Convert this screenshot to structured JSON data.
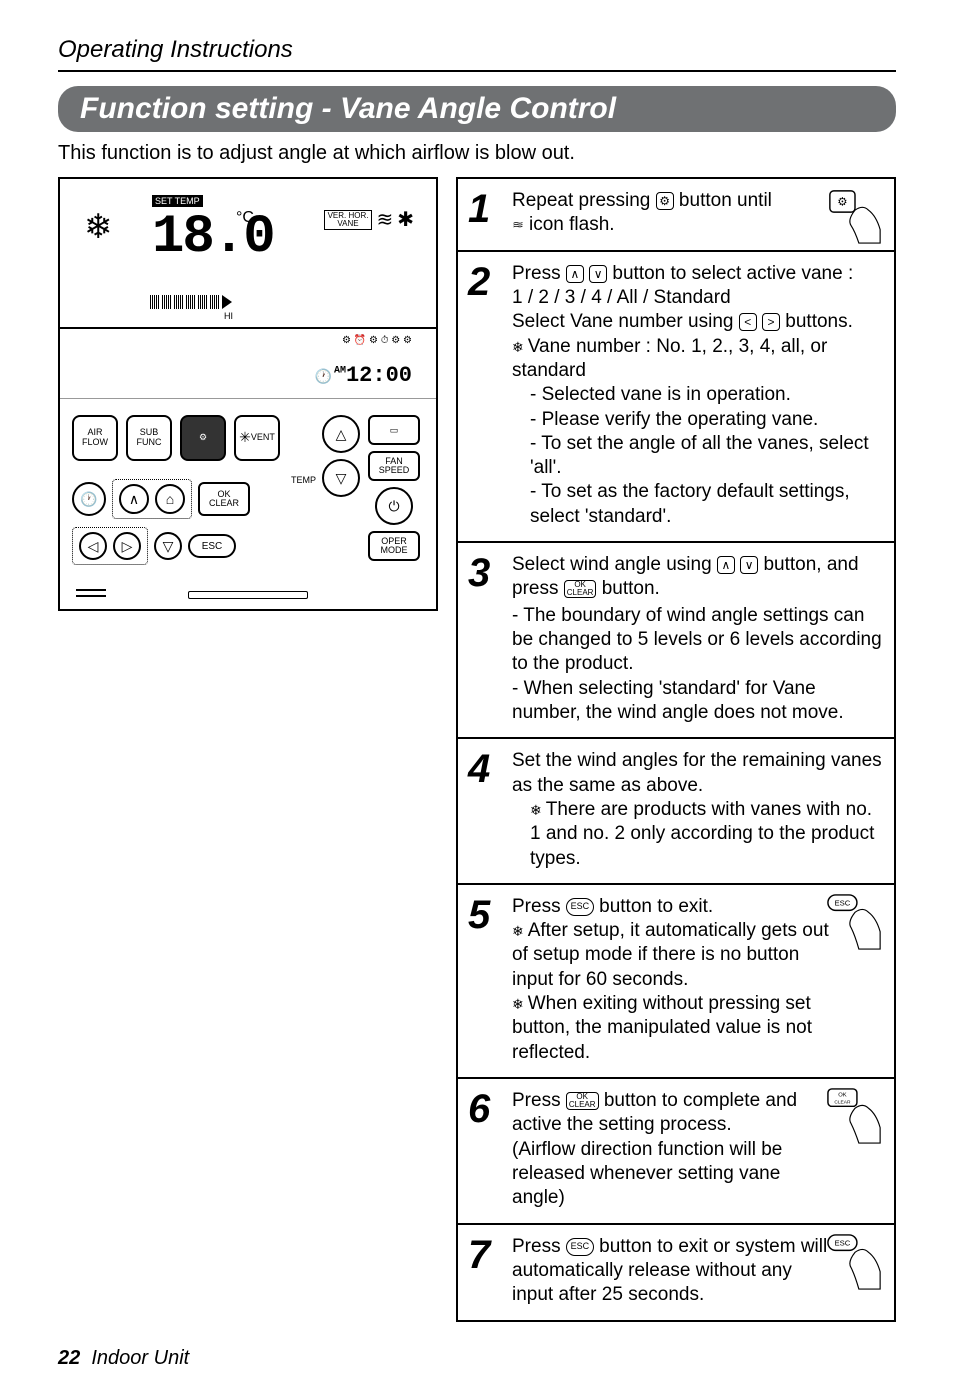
{
  "header": {
    "title": "Operating Instructions"
  },
  "banner": "Function setting - Vane Angle Control",
  "subtitle": "This function is to adjust angle at which airflow is blow out.",
  "lcd": {
    "settemp_label": "SET TEMP",
    "temp_value": "18.0",
    "temp_unit": "°C",
    "ver_hor": "VER. HOR.\nVANE",
    "hi": "HI",
    "clock_am": "AM",
    "clock": "12:00",
    "below_icons": "⚙ ⏰ ⚙ ⏱ ⚙ ⚙"
  },
  "buttons": {
    "air_flow": "AIR\nFLOW",
    "sub_func": "SUB\nFUNC",
    "vent": "VENT",
    "fan_speed": "FAN\nSPEED",
    "ok_clear": "OK\nCLEAR",
    "oper_mode": "OPER\nMODE",
    "temp_label": "TEMP",
    "esc": "ESC"
  },
  "steps": {
    "s1": {
      "t1": "Repeat pressing ",
      "t2": " button until",
      "t3": " icon flash."
    },
    "s2": {
      "l1a": "Press ",
      "l1b": " button to select active vane :",
      "l2": "1 / 2 / 3 / 4 / All / Standard",
      "l3a": "Select Vane number using ",
      "l3b": " buttons.",
      "l4": "Vane number : No. 1, 2., 3, 4, all, or standard",
      "l5": "- Selected vane is in operation.",
      "l6": "- Please verify the operating vane.",
      "l7": "- To set the angle of all the vanes, select 'all'.",
      "l8": "- To set as the factory default settings, select 'standard'."
    },
    "s3": {
      "l1a": "Select wind angle using ",
      "l1b": " button, and press ",
      "l1c": " button.",
      "l2": "- The boundary of wind angle settings can be changed to 5 levels or 6 levels according to the product.",
      "l3": "- When selecting 'standard' for Vane number, the wind angle does not move."
    },
    "s4": {
      "l1": "Set the wind angles for the remaining vanes as the same as above.",
      "l2": "There are products with vanes with no. 1 and no. 2 only according to the product types."
    },
    "s5": {
      "l1a": "Press ",
      "l1b": " button to exit.",
      "l2": "After setup, it automatically gets out of setup mode if there is no button input for 60 seconds.",
      "l3": "When exiting without pressing set button, the manipulated value is not reflected."
    },
    "s6": {
      "l1a": "Press ",
      "l1b": " button to complete and active the setting process.",
      "l2": "(Airflow direction function will be released whenever setting vane angle)"
    },
    "s7": {
      "l1a": "Press ",
      "l1b": " button to exit or system will automatically release without any input after 25 seconds."
    }
  },
  "icons": {
    "gear": "⚙",
    "up": "∧",
    "down": "∨",
    "left": "<",
    "right": ">",
    "ok_clear": "OK\nCLEAR",
    "esc": "ESC",
    "wavy": "≋"
  },
  "footer": {
    "page": "22",
    "label": "Indoor Unit"
  }
}
